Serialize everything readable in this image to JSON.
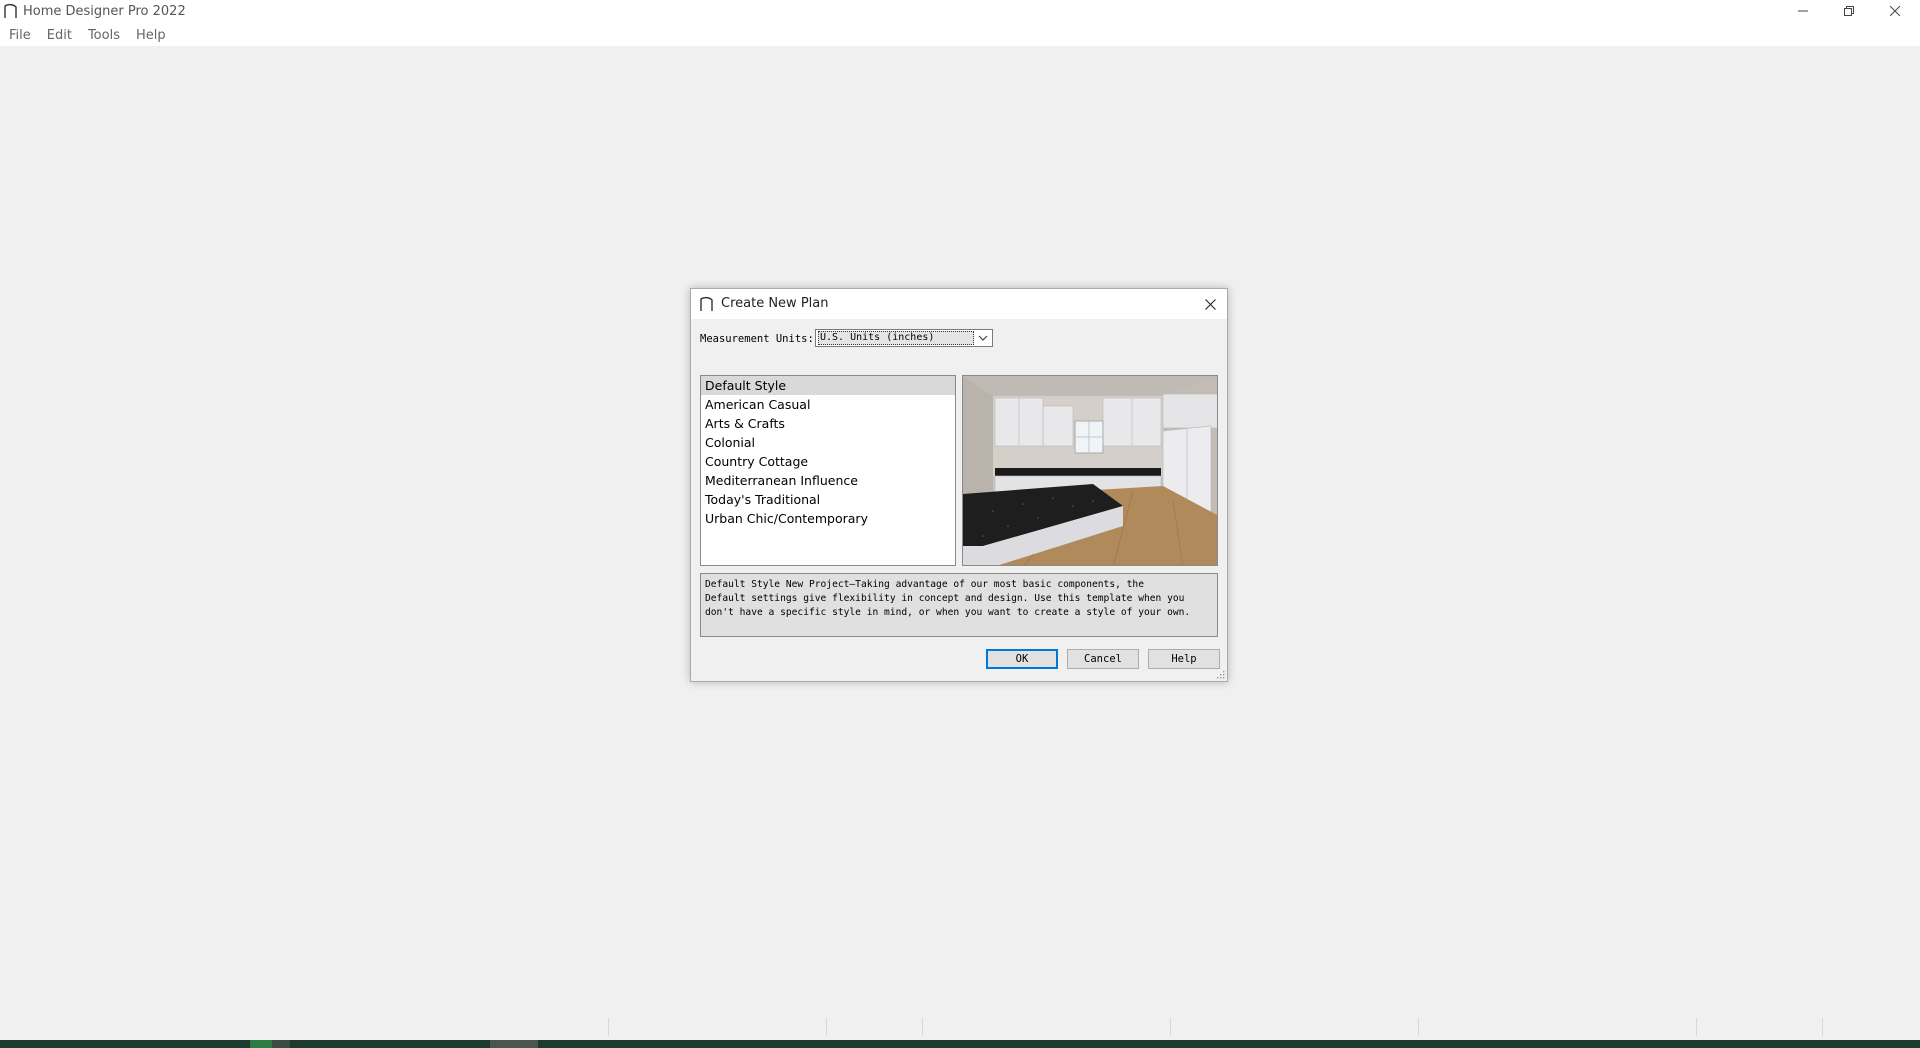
{
  "app": {
    "title": "Home Designer Pro 2022",
    "menu": [
      "File",
      "Edit",
      "Tools",
      "Help"
    ]
  },
  "dialog": {
    "title": "Create New Plan",
    "units_label": "Measurement Units:",
    "units_value": "U.S. Units (inches)",
    "styles": [
      "Default Style",
      "American Casual",
      "Arts & Crafts",
      "Colonial",
      "Country Cottage",
      "Mediterranean Influence",
      "Today's Traditional",
      "Urban Chic/Contemporary"
    ],
    "selected_style": "Default Style",
    "description_lines": [
      "Default Style New Project—Taking advantage of our most basic components, the",
      "Default settings give flexibility in concept and design. Use this template when you",
      "don't have a specific style in mind, or when you want to create a style of your own."
    ],
    "buttons": {
      "ok": "OK",
      "cancel": "Cancel",
      "help": "Help"
    }
  },
  "colors": {
    "background": "#f0f0f0",
    "accent": "#0078d7",
    "taskbar": "#1c3a2e"
  }
}
